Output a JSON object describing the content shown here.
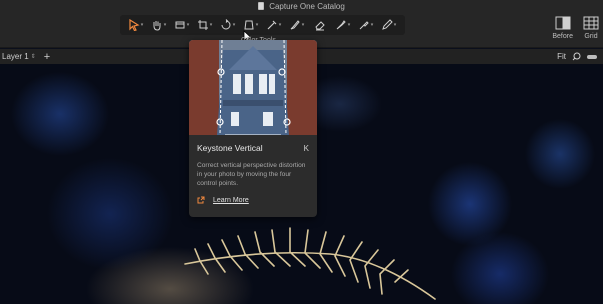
{
  "window": {
    "title": "Capture One Catalog"
  },
  "toolbar": {
    "tools": [
      {
        "icon": "select-arrow-icon",
        "active": true
      },
      {
        "icon": "pan-hand-icon",
        "active": false
      },
      {
        "icon": "loupe-icon",
        "active": false
      },
      {
        "icon": "crop-icon",
        "active": false
      },
      {
        "icon": "rotate-icon",
        "active": false
      },
      {
        "icon": "keystone-icon",
        "active": false
      },
      {
        "icon": "color-picker-icon",
        "active": false
      },
      {
        "icon": "brush-icon",
        "active": false
      },
      {
        "icon": "eraser-icon",
        "active": false
      },
      {
        "icon": "gradient-icon",
        "active": false
      },
      {
        "icon": "heal-icon",
        "active": false
      },
      {
        "icon": "annotate-icon",
        "active": false
      }
    ],
    "hover_label": "Color Tools",
    "before_label": "Before",
    "grid_label": "Grid",
    "accent": "#f0883e"
  },
  "subbar": {
    "layer": "Layer 1",
    "add_layer": "+",
    "fit_label": "Fit"
  },
  "popup": {
    "title": "Keystone Vertical",
    "shortcut": "K",
    "description": "Correct vertical perspective distortion in your photo by moving the four control points.",
    "learn_more": "Learn More"
  }
}
